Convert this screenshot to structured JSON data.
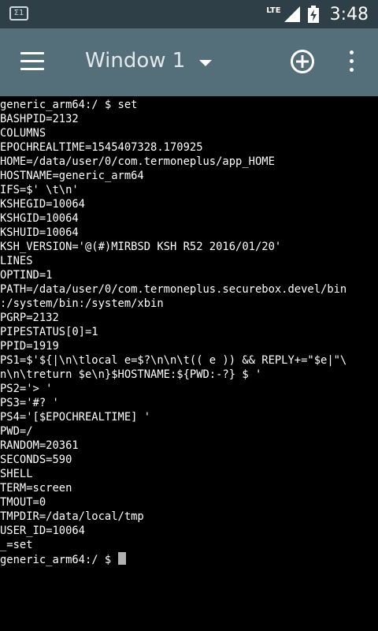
{
  "status_bar": {
    "left_icon_text": "Σ1",
    "network": "LTE",
    "time": "3:48"
  },
  "toolbar": {
    "title": "Window 1",
    "menu_icon": "hamburger-menu-icon",
    "add_icon": "add-circle-icon",
    "more_icon": "overflow-menu-icon"
  },
  "terminal": {
    "lines": [
      "generic_arm64:/ $ set",
      "BASHPID=2132",
      "COLUMNS",
      "EPOCHREALTIME=1545407328.170925",
      "HOME=/data/user/0/com.termoneplus/app_HOME",
      "HOSTNAME=generic_arm64",
      "IFS=$' \\t\\n'",
      "KSHEGID=10064",
      "KSHGID=10064",
      "KSHUID=10064",
      "KSH_VERSION='@(#)MIRBSD KSH R52 2016/01/20'",
      "LINES",
      "OPTIND=1",
      "PATH=/data/user/0/com.termoneplus.securebox.devel/bin",
      ":/system/bin:/system/xbin",
      "PGRP=2132",
      "PIPESTATUS[0]=1",
      "PPID=1919",
      "PS1=$'${|\\n\\tlocal e=$?\\n\\n\\t(( e )) && REPLY+=\"$e|\"\\",
      "n\\n\\treturn $e\\n}$HOSTNAME:${PWD:-?} $ '",
      "PS2='> '",
      "PS3='#? '",
      "PS4='[$EPOCHREALTIME] '",
      "PWD=/",
      "RANDOM=20361",
      "SECONDS=590",
      "SHELL",
      "TERM=screen",
      "TMOUT=0",
      "TMPDIR=/data/local/tmp",
      "USER_ID=10064",
      "_=set"
    ],
    "prompt": "generic_arm64:/ $ "
  }
}
